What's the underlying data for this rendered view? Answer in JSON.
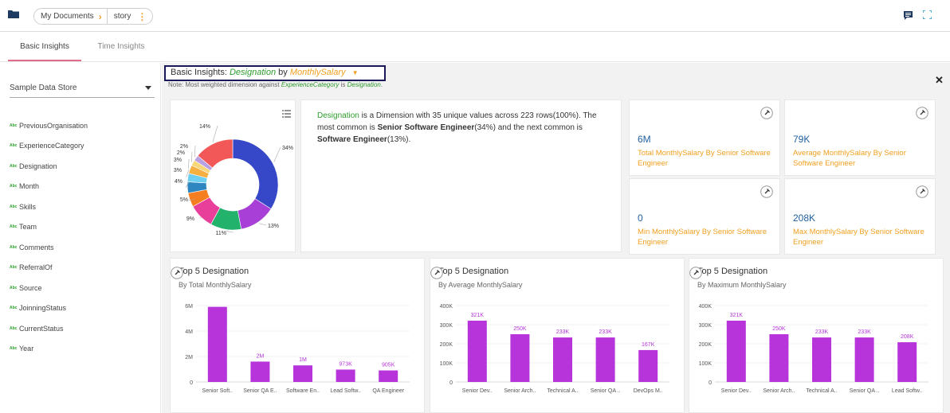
{
  "topbar": {
    "breadcrumb": [
      "My Documents",
      "story"
    ],
    "icons": [
      "folder-icon",
      "chevron-right-icon",
      "more-vertical-icon",
      "comment-icon",
      "expand-icon"
    ]
  },
  "tabs": [
    {
      "label": "Basic Insights",
      "active": true
    },
    {
      "label": "Time Insights",
      "active": false
    }
  ],
  "sidebar": {
    "store": "Sample Data Store",
    "dimension_badge": "Abc",
    "dimensions": [
      "PreviousOrganisation",
      "ExperienceCategory",
      "Designation",
      "Month",
      "Skills",
      "Team",
      "Comments",
      "ReferralOf",
      "Source",
      "JoinningStatus",
      "CurrentStatus",
      "Year"
    ]
  },
  "header": {
    "prefix": "Basic Insights:",
    "dimension": "Designation",
    "by": "by",
    "measure": "MonthlySalary",
    "note_prefix": "Note: Most weighted dimension against",
    "note_field": "ExperienceCategory",
    "note_is": "is",
    "note_value": "Designation",
    "note_end": "."
  },
  "summary": {
    "dimension": "Designation",
    "t1": " is a Dimension with 35 unique values across 223 rows(100%). The most common is ",
    "top1": "Senior Software Engineer",
    "t2": "(34%) and the next common is ",
    "top2": "Software Engineer",
    "t3": "(13%)."
  },
  "kpis": [
    {
      "value": "6M",
      "label": "Total MonthlySalary By Senior Software Engineer"
    },
    {
      "value": "79K",
      "label": "Average MonthlySalary By Senior Software Engineer"
    },
    {
      "value": "0",
      "label": "Min MonthlySalary By Senior Software Engineer"
    },
    {
      "value": "208K",
      "label": "Max MonthlySalary By Senior Software Engineer"
    }
  ],
  "colors": {
    "accent": "#f0a020",
    "green": "#2e9c2e",
    "bar": "#b634d9",
    "kpi_value": "#1f5f9f"
  },
  "chart_data": [
    {
      "type": "pie",
      "labels": [
        "34%",
        "13%",
        "11%",
        "9%",
        "5%",
        "4%",
        "3%",
        "3%",
        "2%",
        "2%",
        "14%"
      ],
      "values": [
        34,
        13,
        11,
        9,
        5,
        4,
        3,
        3,
        2,
        2,
        14
      ],
      "colors": [
        "#3648c8",
        "#a83fd6",
        "#23b26b",
        "#e8409a",
        "#f47e20",
        "#2e86c1",
        "#6ecff0",
        "#f5b041",
        "#f7d778",
        "#b9a0e0",
        "#f25858"
      ]
    },
    {
      "type": "bar",
      "title": "Top 5 Designation",
      "subtitle": "By Total MonthlySalary",
      "categories": [
        "Senior Soft..",
        "Senior QA E..",
        "Software En..",
        "Lead Softw..",
        "QA Engineer"
      ],
      "values": [
        5900000,
        1600000,
        1300000,
        973000,
        905000
      ],
      "data_labels": [
        "",
        "2M",
        "1M",
        "973K",
        "905K"
      ],
      "yticks": [
        "0",
        "2M",
        "4M",
        "6M"
      ],
      "ylim": [
        0,
        6000000
      ]
    },
    {
      "type": "bar",
      "title": "Top 5 Designation",
      "subtitle": "By Average MonthlySalary",
      "categories": [
        "Senior Dev..",
        "Senior Arch..",
        "Technical A..",
        "Senior QA ..",
        "DevOps M.."
      ],
      "values": [
        321000,
        250000,
        233000,
        233000,
        167000
      ],
      "data_labels": [
        "321K",
        "250K",
        "233K",
        "233K",
        "167K"
      ],
      "yticks": [
        "0",
        "100K",
        "200K",
        "300K",
        "400K"
      ],
      "ylim": [
        0,
        400000
      ]
    },
    {
      "type": "bar",
      "title": "Top 5 Designation",
      "subtitle": "By Maximum MonthlySalary",
      "categories": [
        "Senior Dev..",
        "Senior Arch..",
        "Technical A..",
        "Senior QA ..",
        "Lead Softw.."
      ],
      "values": [
        321000,
        250000,
        233000,
        233000,
        208000
      ],
      "data_labels": [
        "321K",
        "250K",
        "233K",
        "233K",
        "208K"
      ],
      "yticks": [
        "0",
        "100K",
        "200K",
        "300K",
        "400K"
      ],
      "ylim": [
        0,
        400000
      ]
    }
  ]
}
